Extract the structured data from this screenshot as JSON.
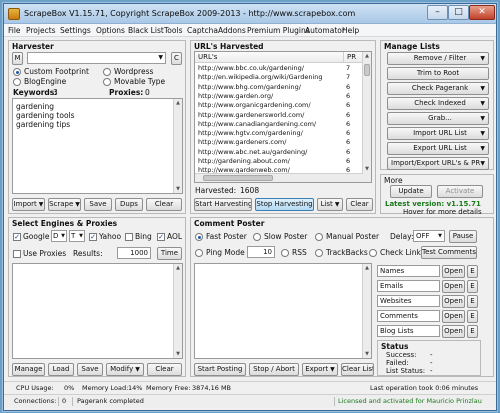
{
  "window": {
    "title": "ScrapeBox V1.15.71, Copyright ScrapeBox 2009-2013 - http://www.scrapebox.com",
    "minimize": "–",
    "maximize": "□",
    "close": "✕"
  },
  "menu": [
    "File",
    "Projects",
    "Settings",
    "Options",
    "Black List",
    "Tools",
    "Captcha",
    "Addons",
    "Premium Plugins",
    "Automator",
    "Help"
  ],
  "harvester": {
    "title": "Harvester",
    "m_button": "M",
    "engine_select": "",
    "c_button": "C",
    "radio_custom": "Custom Footprint",
    "radio_wordpress": "Wordpress",
    "radio_blogengine": "BlogEngine",
    "radio_movabletype": "Movable Type",
    "keywords_label": "Keywords:",
    "keywords_count": "3",
    "proxies_label": "Proxies:",
    "proxies_count": "0",
    "keywords": [
      "gardening",
      "gardening tools",
      "gardening tips"
    ],
    "buttons": {
      "import": "Import",
      "scrape": "Scrape",
      "save": "Save",
      "dups": "Dups",
      "clear": "Clear"
    }
  },
  "urls": {
    "title": "URL's Harvested",
    "col_url": "URL's",
    "col_pr": "PR",
    "rows": [
      {
        "url": "http://www.bbc.co.uk/gardening/",
        "pr": "7"
      },
      {
        "url": "http://en.wikipedia.org/wiki/Gardening",
        "pr": "7"
      },
      {
        "url": "http://www.bhg.com/gardening/",
        "pr": "6"
      },
      {
        "url": "http://www.garden.org/",
        "pr": "6"
      },
      {
        "url": "http://www.organicgardening.com/",
        "pr": "6"
      },
      {
        "url": "http://www.gardenersworld.com/",
        "pr": "6"
      },
      {
        "url": "http://www.canadiangardening.com/",
        "pr": "6"
      },
      {
        "url": "http://www.hgtv.com/gardening/",
        "pr": "6"
      },
      {
        "url": "http://www.gardeners.com/",
        "pr": "6"
      },
      {
        "url": "http://www.abc.net.au/gardening/",
        "pr": "6"
      },
      {
        "url": "http://gardening.about.com/",
        "pr": "6"
      },
      {
        "url": "http://www.gardenweb.com/",
        "pr": "6"
      }
    ],
    "harvested_label": "Harvested:",
    "harvested_count": "1608",
    "buttons": {
      "start": "Start Harvesting",
      "stop": "Stop Harvesting",
      "list": "List",
      "clear": "Clear"
    }
  },
  "manage": {
    "title": "Manage Lists",
    "buttons": [
      "Remove / Filter",
      "Trim to Root",
      "Check Pagerank",
      "Check Indexed",
      "Grab...",
      "Import URL List",
      "Export URL List",
      "Import/Export URL's & PR"
    ]
  },
  "more": {
    "title": "More",
    "update": "Update",
    "activate": "Activate",
    "latest": "Latest version: v1.15.71",
    "hover": "Hover for more details",
    "accent": "#1a7a1a"
  },
  "engines": {
    "title": "Select Engines & Proxies",
    "google": "Google",
    "google_sel1": "D",
    "google_sel2": "T",
    "yahoo": "Yahoo",
    "bing": "Bing",
    "aol": "AOL",
    "use_proxies": "Use Proxies",
    "results_label": "Results:",
    "results_value": "1000",
    "time": "Time",
    "buttons": {
      "manage": "Manage",
      "load": "Load",
      "save": "Save",
      "modify": "Modify",
      "clear": "Clear"
    }
  },
  "poster": {
    "title": "Comment Poster",
    "fast": "Fast Poster",
    "slow": "Slow Poster",
    "manual": "Manual Poster",
    "delay_label": "Delay:",
    "delay_value": "OFF",
    "pause": "Pause",
    "ping": "Ping Mode",
    "ping_value": "10",
    "rss": "RSS",
    "trackbacks": "TrackBacks",
    "check_links": "Check Links",
    "test_comments": "Test Comments",
    "lists": [
      {
        "label": "Names",
        "open": "Open",
        "e": "E"
      },
      {
        "label": "Emails",
        "open": "Open",
        "e": "E"
      },
      {
        "label": "Websites",
        "open": "Open",
        "e": "E"
      },
      {
        "label": "Comments",
        "open": "Open",
        "e": "E"
      },
      {
        "label": "Blog Lists",
        "open": "Open",
        "e": "E"
      }
    ],
    "status_title": "Status",
    "success_label": "Success:",
    "success_value": "-",
    "failed_label": "Failed:",
    "failed_value": "-",
    "liststatus_label": "List Status:",
    "liststatus_value": "-",
    "buttons": {
      "start": "Start Posting",
      "stop": "Stop / Abort",
      "export": "Export",
      "clear": "Clear List"
    }
  },
  "status": {
    "cpu_label": "CPU Usage:",
    "cpu_value": "0%",
    "mem_label": "Memory Load:",
    "mem_value": "14%",
    "free_label": "Memory Free:",
    "free_value": "3874,16 MB",
    "last_op": "Last operation took 0:06 minutes",
    "connections": "Connections:",
    "conn_value": "0",
    "pagerank": "Pagerank completed",
    "licensed": "Licensed and activated for Mauricio Prinzlau"
  }
}
